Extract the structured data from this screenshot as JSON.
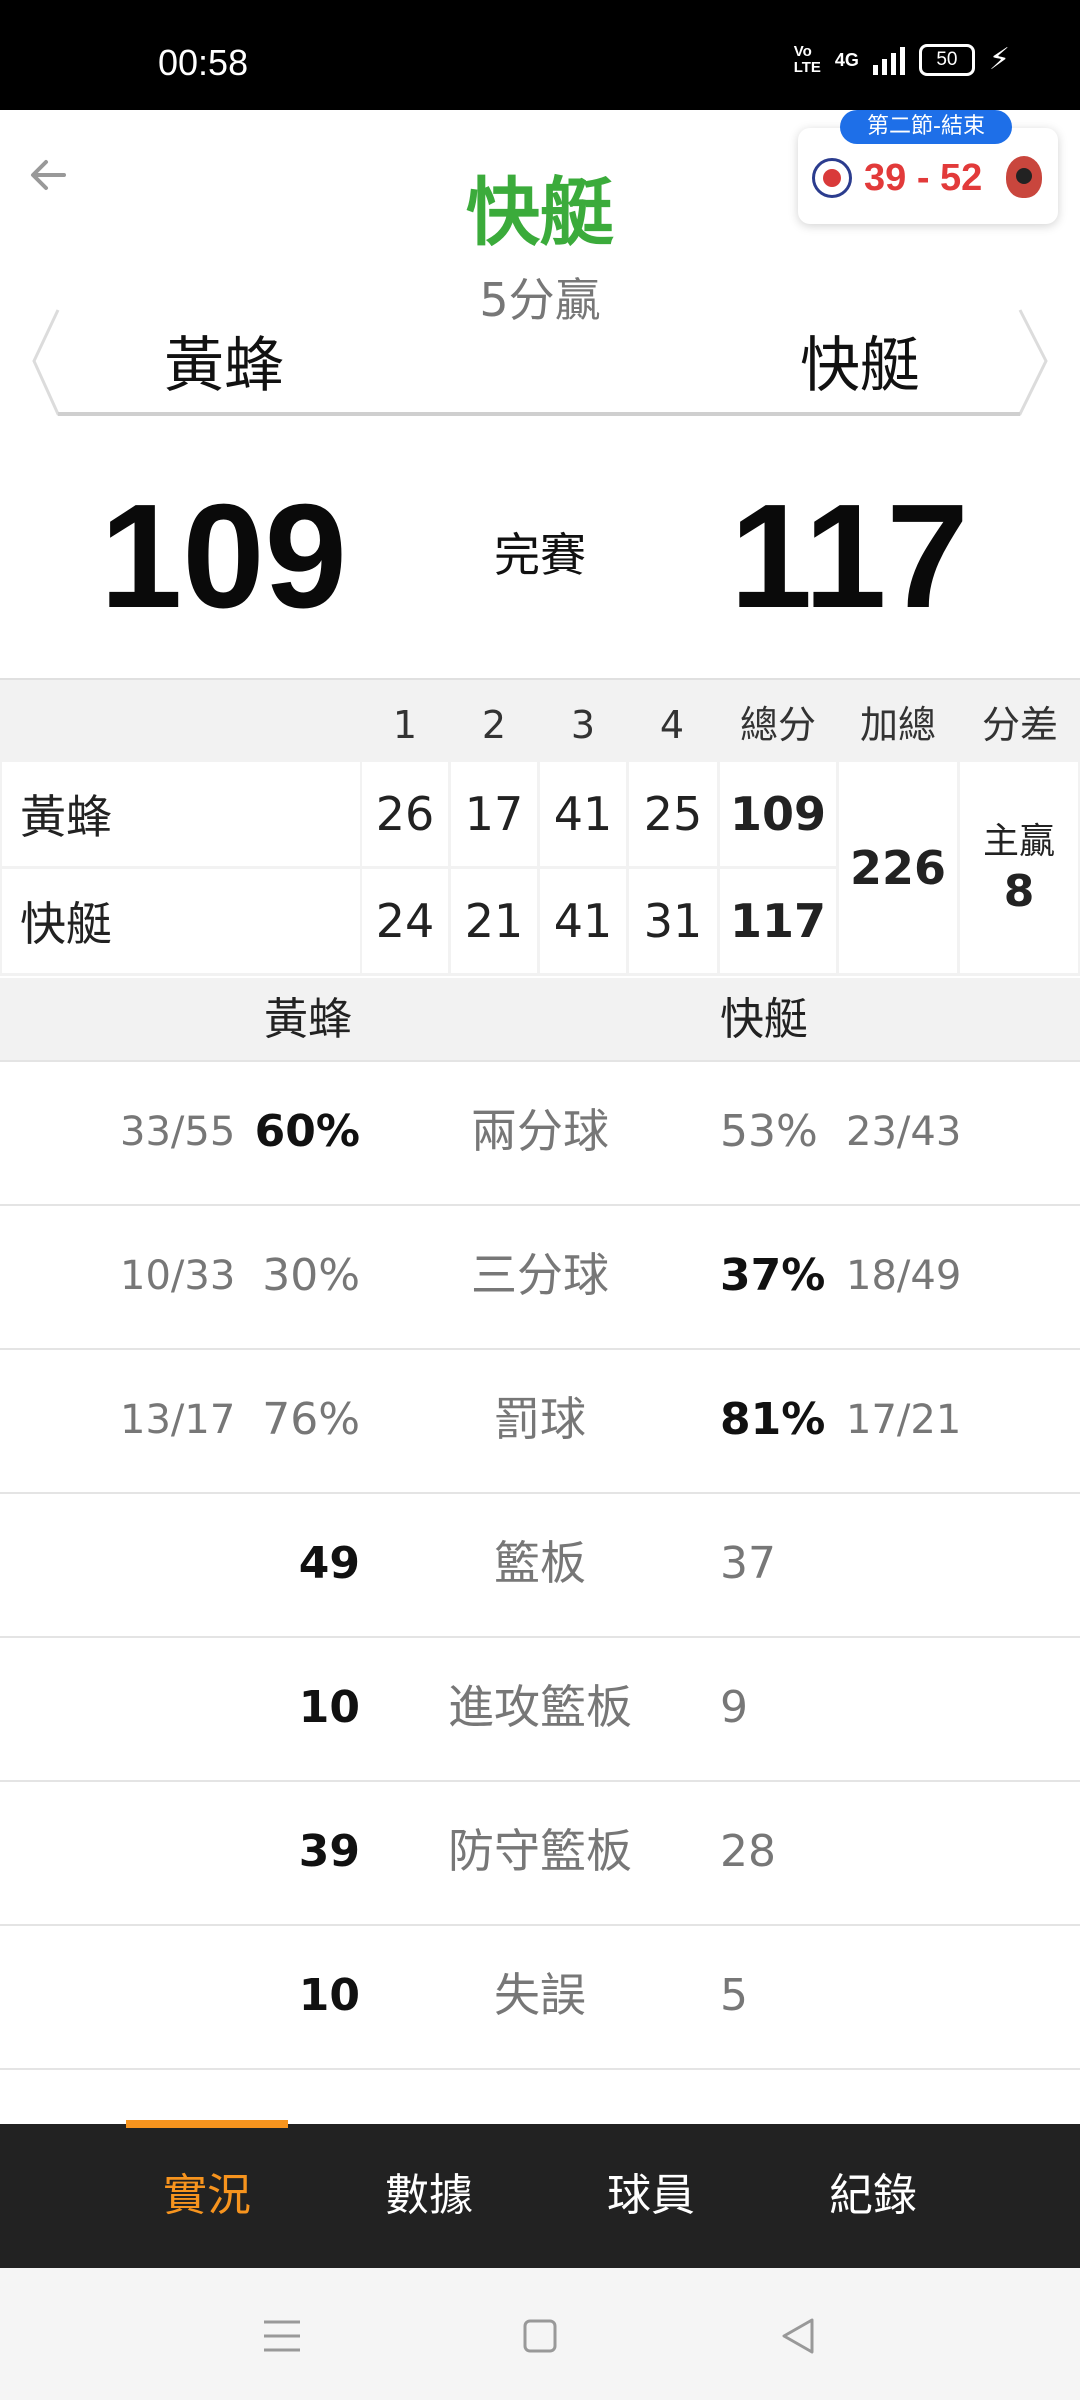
{
  "status_bar": {
    "time": "00:58",
    "volte": "Vo\nLTE",
    "network": "4G",
    "battery": "50"
  },
  "header": {
    "title": "快艇",
    "result_note": "5分贏",
    "team_left": "黃蜂",
    "team_right": "快艇",
    "score_left": "109",
    "score_right": "117",
    "game_status": "完賽"
  },
  "score_widget": {
    "badge": "第二節-結束",
    "score": "39 - 52"
  },
  "quarter_table": {
    "columns": [
      "1",
      "2",
      "3",
      "4",
      "總分",
      "加總",
      "分差"
    ],
    "rows": [
      {
        "team": "黃蜂",
        "q": [
          "26",
          "17",
          "41",
          "25"
        ],
        "total": "109"
      },
      {
        "team": "快艇",
        "q": [
          "24",
          "21",
          "41",
          "31"
        ],
        "total": "117"
      }
    ],
    "sum": "226",
    "diff_label": "主贏",
    "diff_value": "8"
  },
  "stats": {
    "team_left": "黃蜂",
    "team_right": "快艇",
    "rows": [
      {
        "label": "兩分球",
        "left_frac": "33/55",
        "left": "60%",
        "right": "53%",
        "right_frac": "23/43",
        "winner": "left"
      },
      {
        "label": "三分球",
        "left_frac": "10/33",
        "left": "30%",
        "right": "37%",
        "right_frac": "18/49",
        "winner": "right"
      },
      {
        "label": "罰球",
        "left_frac": "13/17",
        "left": "76%",
        "right": "81%",
        "right_frac": "17/21",
        "winner": "right"
      },
      {
        "label": "籃板",
        "left_frac": "",
        "left": "49",
        "right": "37",
        "right_frac": "",
        "winner": "left"
      },
      {
        "label": "進攻籃板",
        "left_frac": "",
        "left": "10",
        "right": "9",
        "right_frac": "",
        "winner": "left"
      },
      {
        "label": "防守籃板",
        "left_frac": "",
        "left": "39",
        "right": "28",
        "right_frac": "",
        "winner": "left"
      },
      {
        "label": "失誤",
        "left_frac": "",
        "left": "10",
        "right": "5",
        "right_frac": "",
        "winner": "left"
      }
    ]
  },
  "tabs": [
    {
      "label": "實況",
      "active": true
    },
    {
      "label": "數據",
      "active": false
    },
    {
      "label": "球員",
      "active": false
    },
    {
      "label": "紀錄",
      "active": false
    }
  ],
  "icons": [
    "back-arrow-icon",
    "menu-icon",
    "home-icon",
    "back-triangle-icon"
  ],
  "colors": {
    "title_green": "#3bab3b",
    "accent_orange": "#f7941e",
    "widget_blue": "#1e6fe8",
    "widget_score_red": "#e23a3a"
  }
}
